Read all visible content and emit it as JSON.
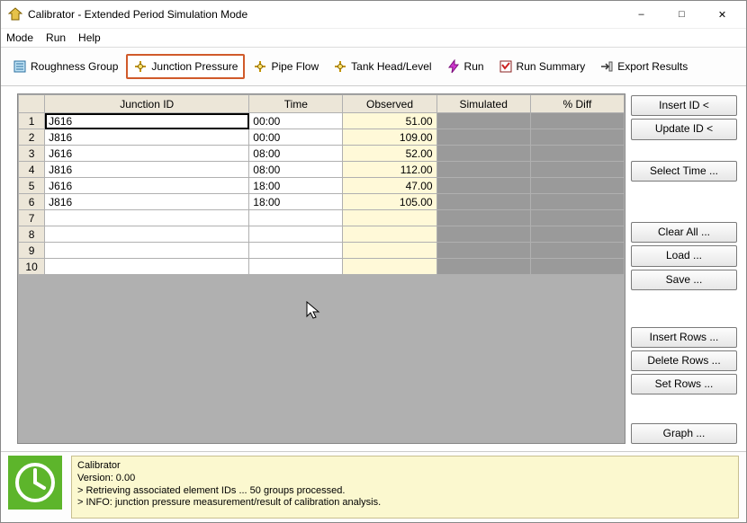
{
  "title": "Calibrator - Extended Period Simulation Mode",
  "menu": {
    "mode": "Mode",
    "run": "Run",
    "help": "Help"
  },
  "toolbar": {
    "roughness": "Roughness Group",
    "junction": "Junction Pressure",
    "pipeflow": "Pipe Flow",
    "tank": "Tank Head/Level",
    "run": "Run",
    "summary": "Run Summary",
    "export": "Export Results"
  },
  "columns": {
    "junction": "Junction ID",
    "time": "Time",
    "observed": "Observed",
    "simulated": "Simulated",
    "diff": "% Diff"
  },
  "rows": [
    {
      "n": "1",
      "junction": "J616",
      "time": "00:00",
      "observed": "51.00"
    },
    {
      "n": "2",
      "junction": "J816",
      "time": "00:00",
      "observed": "109.00"
    },
    {
      "n": "3",
      "junction": "J616",
      "time": "08:00",
      "observed": "52.00"
    },
    {
      "n": "4",
      "junction": "J816",
      "time": "08:00",
      "observed": "112.00"
    },
    {
      "n": "5",
      "junction": "J616",
      "time": "18:00",
      "observed": "47.00"
    },
    {
      "n": "6",
      "junction": "J816",
      "time": "18:00",
      "observed": "105.00"
    },
    {
      "n": "7",
      "junction": "",
      "time": "",
      "observed": ""
    },
    {
      "n": "8",
      "junction": "",
      "time": "",
      "observed": ""
    },
    {
      "n": "9",
      "junction": "",
      "time": "",
      "observed": ""
    },
    {
      "n": "10",
      "junction": "",
      "time": "",
      "observed": ""
    }
  ],
  "side": {
    "insertid": "Insert ID <",
    "updateid": "Update ID <",
    "selecttime": "Select Time ...",
    "clearall": "Clear All ...",
    "load": "Load ...",
    "save": "Save ...",
    "insertrows": "Insert Rows ...",
    "deleterows": "Delete Rows ...",
    "setrows": "Set Rows ...",
    "graph": "Graph ..."
  },
  "log": {
    "l1": "Calibrator",
    "l2": "Version: 0.00",
    "l3": "> Retrieving associated element IDs ... 50 groups processed.",
    "l4": "> INFO: junction pressure measurement/result of calibration analysis."
  }
}
